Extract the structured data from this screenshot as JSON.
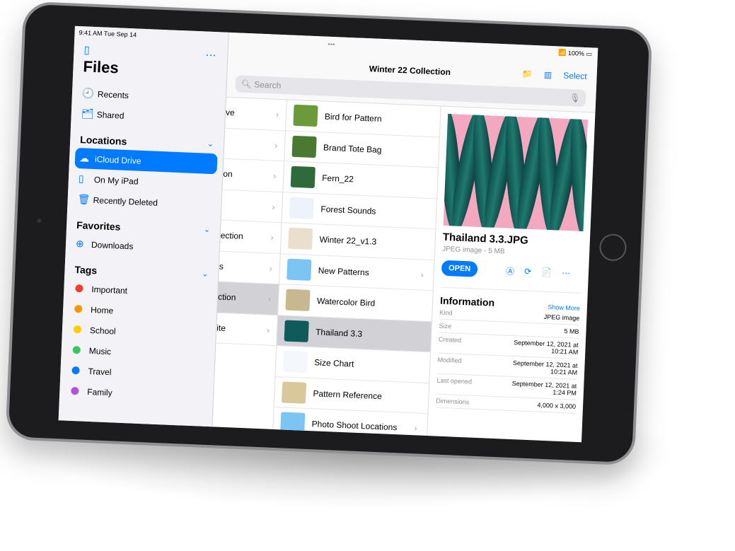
{
  "status": {
    "time_date": "9:41 AM  Tue Sep 14",
    "battery": "100%"
  },
  "sidebar": {
    "title": "Files",
    "recents": "Recents",
    "shared": "Shared",
    "locations_header": "Locations",
    "locations": [
      {
        "label": "iCloud Drive",
        "icon": "cloud-icon"
      },
      {
        "label": "On My iPad",
        "icon": "ipad-icon"
      },
      {
        "label": "Recently Deleted",
        "icon": "trash-icon"
      }
    ],
    "favorites_header": "Favorites",
    "favorites": [
      {
        "label": "Downloads",
        "icon": "download-icon"
      }
    ],
    "tags_header": "Tags",
    "tags": [
      {
        "label": "Important",
        "color": "#ff3b30"
      },
      {
        "label": "Home",
        "color": "#ff9500"
      },
      {
        "label": "School",
        "color": "#ffcc00"
      },
      {
        "label": "Music",
        "color": "#34c759"
      },
      {
        "label": "Travel",
        "color": "#007aff"
      },
      {
        "label": "Family",
        "color": "#af52de"
      }
    ]
  },
  "header": {
    "title": "Winter 22 Collection",
    "select": "Select",
    "search_placeholder": "Search"
  },
  "folders": [
    "ve",
    "",
    "on",
    "",
    "ection",
    "s",
    "ction",
    "ite"
  ],
  "files": [
    {
      "name": "Bird for Pattern"
    },
    {
      "name": "Brand Tote Bag"
    },
    {
      "name": "Fern_22"
    },
    {
      "name": "Forest Sounds"
    },
    {
      "name": "Winter 22_v1.3"
    },
    {
      "name": "New Patterns",
      "folder": true
    },
    {
      "name": "Watercolor Bird"
    },
    {
      "name": "Thailand 3.3",
      "selected": true
    },
    {
      "name": "Size Chart"
    },
    {
      "name": "Pattern Reference"
    },
    {
      "name": "Photo Shoot Locations",
      "folder": true
    }
  ],
  "detail": {
    "name": "Thailand 3.3.JPG",
    "subtitle": "JPEG image - 5 MB",
    "open": "OPEN",
    "info_title": "Information",
    "show_more": "Show More",
    "info": [
      {
        "k": "Kind",
        "v": "JPEG image"
      },
      {
        "k": "Size",
        "v": "5 MB"
      },
      {
        "k": "Created",
        "v": "September 12, 2021 at\n10:21 AM"
      },
      {
        "k": "Modified",
        "v": "September 12, 2021 at\n10:21 AM"
      },
      {
        "k": "Last opened",
        "v": "September 12, 2021 at\n1:24 PM"
      },
      {
        "k": "Dimensions",
        "v": "4,000 x 3,000"
      }
    ]
  }
}
